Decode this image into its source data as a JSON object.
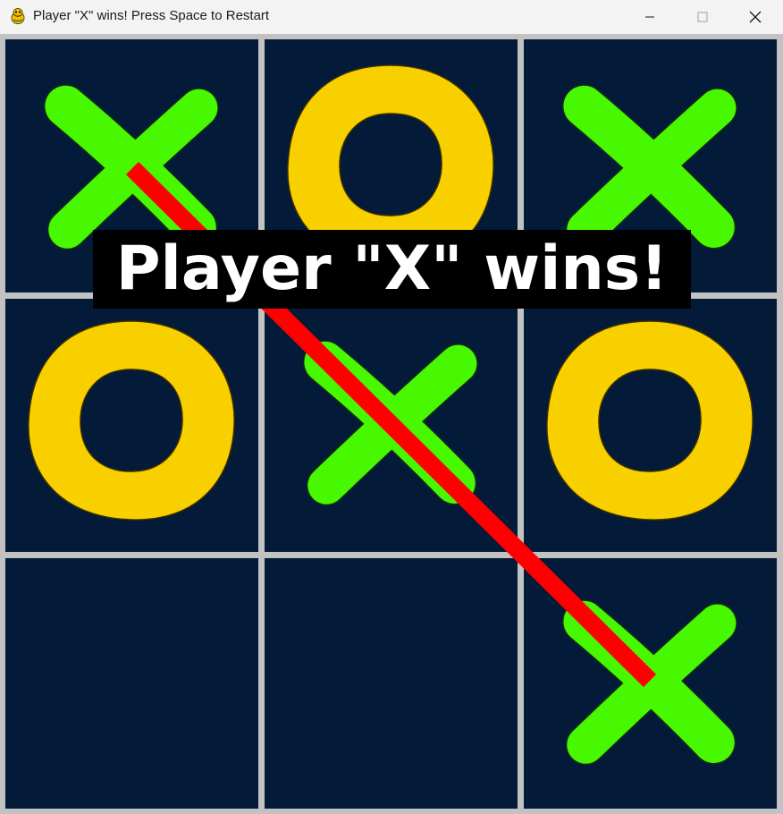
{
  "window": {
    "title": "Player \"X\" wins! Press Space to Restart",
    "app_icon": "pygame-snake-icon",
    "controls": {
      "minimize_icon": "minimize-icon",
      "maximize_icon": "maximize-icon",
      "close_icon": "close-icon"
    }
  },
  "game": {
    "board": [
      [
        "X",
        "O",
        "X"
      ],
      [
        "O",
        "X",
        "O"
      ],
      [
        "",
        "",
        "X"
      ]
    ],
    "winner": "X",
    "winning_line": "diagonal top-left to bottom-right",
    "banner_text": "Player \"X\" wins!",
    "colors": {
      "x_mark": "#47f800",
      "o_mark": "#f8d000",
      "cell_background": "#031a38",
      "grid_lines": "#c2c2c2",
      "win_line": "#ff0000",
      "banner_background": "#000000",
      "banner_text": "#ffffff"
    }
  }
}
